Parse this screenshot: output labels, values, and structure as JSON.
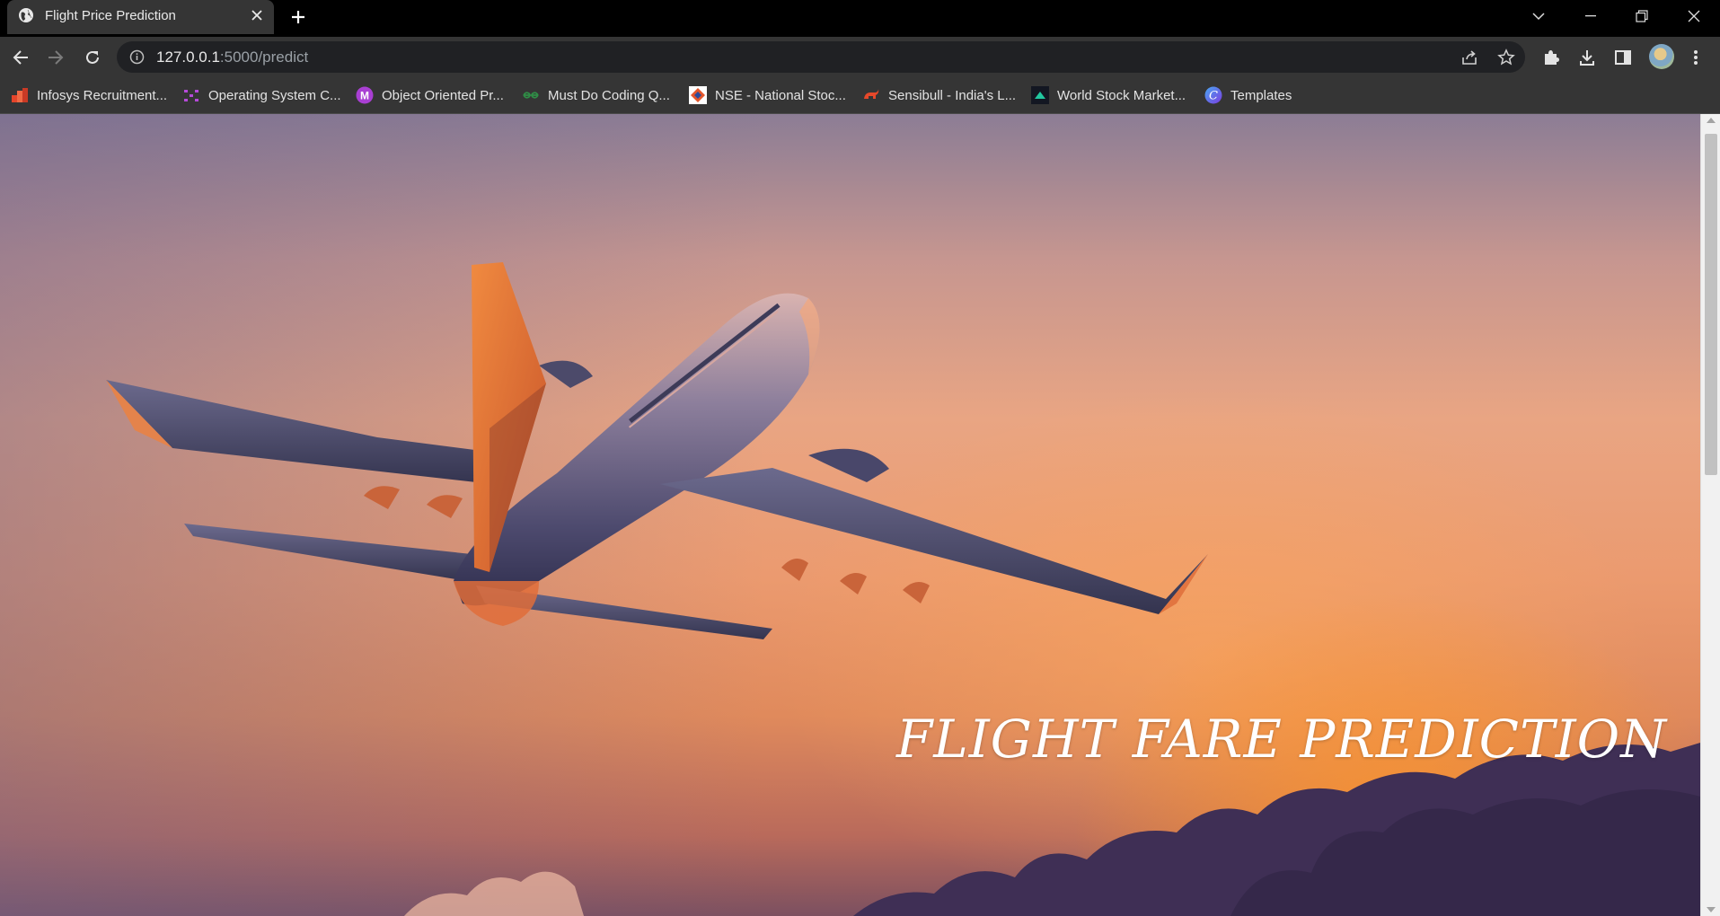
{
  "tab": {
    "title": "Flight Price Prediction"
  },
  "address_bar": {
    "url_host": "127.0.0.1",
    "url_path": ":5000/predict"
  },
  "bookmarks": [
    {
      "label": "Infosys Recruitment...",
      "icon": "infosys-icon",
      "color": "#e5452b"
    },
    {
      "label": "Operating System C...",
      "icon": "dots-icon",
      "color": "#b64ad9"
    },
    {
      "label": "Object Oriented Pr...",
      "icon": "m-circle-icon",
      "color": "#a93fd3"
    },
    {
      "label": "Must Do Coding Q...",
      "icon": "geeks-icon",
      "color": "#2f8d46"
    },
    {
      "label": "NSE - National Stoc...",
      "icon": "nse-icon",
      "color": "#e3572c"
    },
    {
      "label": "Sensibull - India's L...",
      "icon": "bull-icon",
      "color": "#e5482a"
    },
    {
      "label": "World Stock Market...",
      "icon": "tradingview-icon",
      "color": "#22c7a0"
    },
    {
      "label": "Templates",
      "icon": "canva-icon",
      "color": "#4aa7f2"
    }
  ],
  "hero": {
    "title": "FLIGHT FARE PREDICTION"
  }
}
